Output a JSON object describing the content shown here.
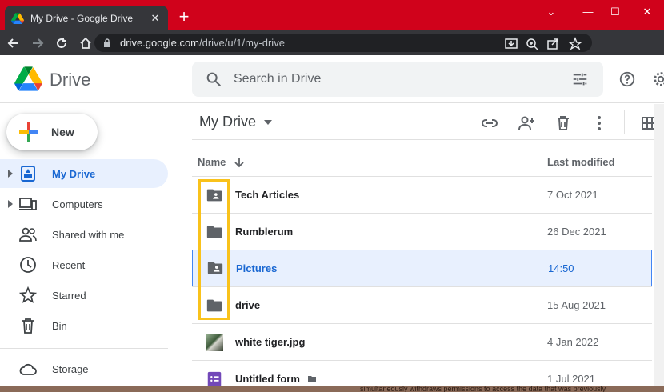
{
  "browser": {
    "tab_title": "My Drive - Google Drive",
    "tab_close": "✕",
    "new_tab": "+",
    "window_controls": {
      "dropdown": "⌄",
      "minimize": "—",
      "maximize": "☐",
      "close": "✕"
    },
    "url_host": "drive.google.com",
    "url_path": "/drive/u/1/my-drive"
  },
  "drive": {
    "logo_text": "Drive",
    "search_placeholder": "Search in Drive"
  },
  "sidebar": {
    "new_label": "New",
    "items": [
      {
        "label": "My Drive",
        "icon": "my-drive-icon",
        "active": true,
        "expandable": true
      },
      {
        "label": "Computers",
        "icon": "computers-icon",
        "active": false,
        "expandable": true
      },
      {
        "label": "Shared with me",
        "icon": "shared-icon",
        "active": false
      },
      {
        "label": "Recent",
        "icon": "clock-icon",
        "active": false
      },
      {
        "label": "Starred",
        "icon": "star-icon",
        "active": false
      },
      {
        "label": "Bin",
        "icon": "bin-icon",
        "active": false
      },
      {
        "label": "Storage",
        "icon": "cloud-icon",
        "active": false
      }
    ]
  },
  "main": {
    "breadcrumb": "My Drive",
    "columns": {
      "name": "Name",
      "modified": "Last modified"
    },
    "files": [
      {
        "name": "Tech Articles",
        "modified": "7 Oct 2021",
        "type": "shared-folder"
      },
      {
        "name": "Rumblerum",
        "modified": "26 Dec 2021",
        "type": "folder"
      },
      {
        "name": "Pictures",
        "modified": "14:50",
        "type": "shared-folder",
        "selected": true
      },
      {
        "name": "drive",
        "modified": "15 Aug 2021",
        "type": "folder"
      },
      {
        "name": "white tiger.jpg",
        "modified": "4 Jan 2022",
        "type": "image"
      },
      {
        "name": "Untitled form",
        "modified": "1 Jul 2021",
        "type": "form"
      }
    ]
  },
  "background_text": "simultaneously withdraws permissions to access the data that was previously",
  "colors": {
    "titlebar": "#d0021b",
    "accent": "#1967d2",
    "highlight_box": "#f9c21b"
  }
}
